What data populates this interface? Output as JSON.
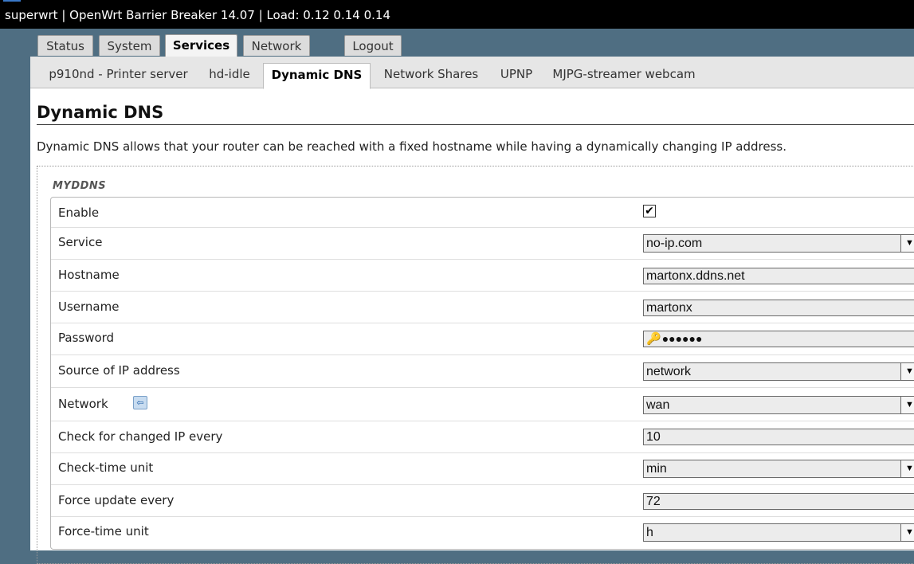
{
  "header": {
    "title": "superwrt | OpenWrt Barrier Breaker 14.07 | Load: 0.12 0.14 0.14"
  },
  "main_tabs": [
    "Status",
    "System",
    "Services",
    "Network",
    "Logout"
  ],
  "active_main_tab": "Services",
  "sub_tabs": [
    "p910nd - Printer server",
    "hd-idle",
    "Dynamic DNS",
    "Network Shares",
    "UPNP",
    "MJPG-streamer webcam"
  ],
  "active_sub_tab": "Dynamic DNS",
  "page": {
    "title": "Dynamic DNS",
    "description": "Dynamic DNS allows that your router can be reached with a fixed hostname while having a dynamically changing IP address."
  },
  "section": {
    "legend": "MYDDNS",
    "fields": {
      "enable": {
        "label": "Enable",
        "checked": true,
        "check_glyph": "✔"
      },
      "service": {
        "label": "Service",
        "value": "no-ip.com"
      },
      "hostname": {
        "label": "Hostname",
        "value": "martonx.ddns.net"
      },
      "username": {
        "label": "Username",
        "value": "martonx"
      },
      "password": {
        "label": "Password",
        "value": "●●●●●●"
      },
      "ip_source": {
        "label": "Source of IP address",
        "value": "network"
      },
      "network": {
        "label": "Network",
        "value": "wan"
      },
      "check_interval": {
        "label": "Check for changed IP every",
        "value": "10"
      },
      "check_unit": {
        "label": "Check-time unit",
        "value": "min"
      },
      "force_interval": {
        "label": "Force update every",
        "value": "72"
      },
      "force_unit": {
        "label": "Force-time unit",
        "value": "h"
      }
    }
  },
  "icons": {
    "dropdown_arrow": "▼",
    "key": "🔑",
    "reveal": "⟳",
    "help": "⇦"
  },
  "colors": {
    "background": "#4f6e82",
    "header_bg": "#000000",
    "tab_bg": "#dcdcdc",
    "input_bg": "#ececec"
  }
}
